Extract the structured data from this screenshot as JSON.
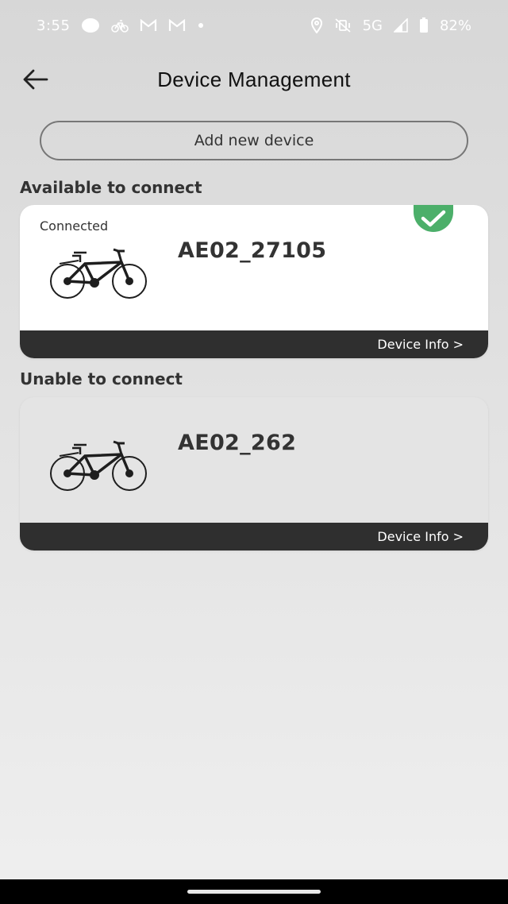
{
  "status_bar": {
    "time": "3:55",
    "network": "5G",
    "battery": "82%",
    "left_icons": [
      "circle-icon",
      "bike-icon",
      "gmail-icon",
      "gmail-icon",
      "dot-icon"
    ],
    "right_icons": [
      "location-icon",
      "vibrate-off-icon",
      "signal-icon",
      "battery-icon"
    ]
  },
  "header": {
    "title": "Device Management",
    "back_icon": "arrow-left-icon"
  },
  "add_device": {
    "label": "Add new device"
  },
  "sections": {
    "available": {
      "title": "Available to connect",
      "device": {
        "status": "Connected",
        "name": "AE02_27105",
        "info_link": "Device Info >"
      }
    },
    "unavailable": {
      "title": "Unable to connect",
      "device": {
        "name": "AE02_262",
        "info_link": "Device Info >"
      }
    }
  },
  "colors": {
    "accent_green": "#4caf6a",
    "card_footer": "#2f2f2f",
    "background_top": "#d7d7d7",
    "background_bottom": "#efefef"
  }
}
